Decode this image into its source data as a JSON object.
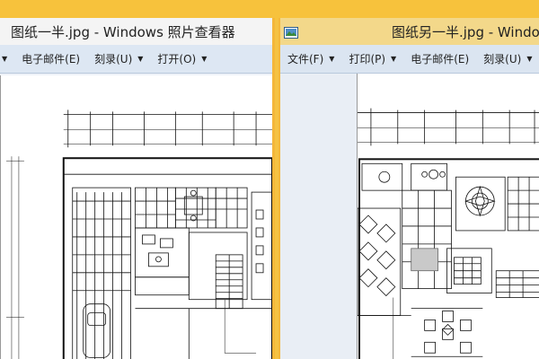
{
  "windows": [
    {
      "title": "图纸一半.jpg - Windows 照片查看器",
      "menu": [
        {
          "label": "电子邮件(E)"
        },
        {
          "label": "刻录(U)"
        },
        {
          "label": "打开(O)"
        }
      ]
    },
    {
      "title": "图纸另一半.jpg - Windows",
      "menu": [
        {
          "label": "文件(F)"
        },
        {
          "label": "打印(P)"
        },
        {
          "label": "电子邮件(E)"
        },
        {
          "label": "刻录(U)"
        }
      ]
    }
  ],
  "colors": {
    "desktop": "#f5c242",
    "menubar": "#dde7f3",
    "viewer_bg": "#eef2f8"
  },
  "icons": {
    "app": "photo-viewer-icon",
    "menu_caret": "caret-down-icon"
  }
}
